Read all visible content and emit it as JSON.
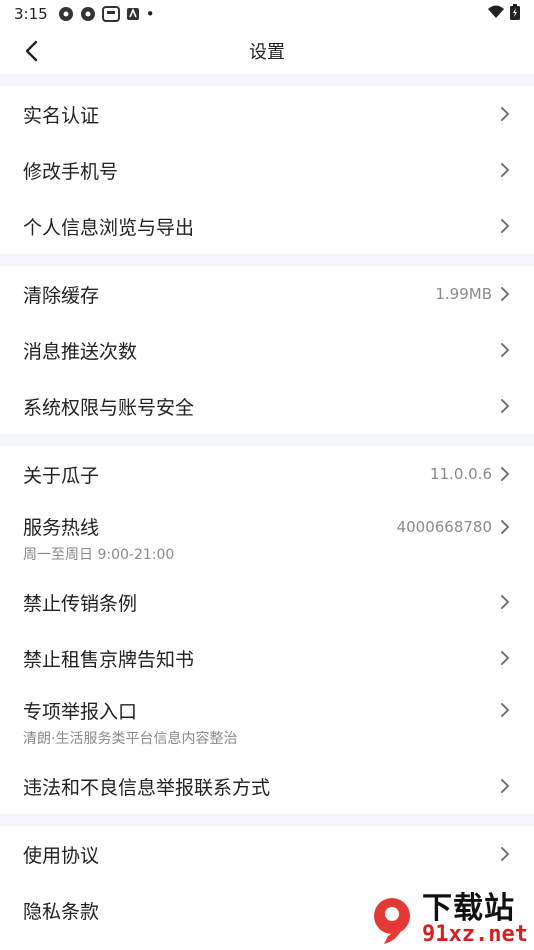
{
  "status_bar": {
    "time": "3:15",
    "icons": [
      "app-icon",
      "app-icon",
      "app-icon",
      "app-icon"
    ],
    "dot": "•"
  },
  "header": {
    "title": "设置",
    "back_icon": "chevron-left-icon"
  },
  "groups": [
    {
      "items": [
        {
          "label": "实名认证"
        },
        {
          "label": "修改手机号"
        },
        {
          "label": "个人信息浏览与导出"
        }
      ]
    },
    {
      "items": [
        {
          "label": "清除缓存",
          "value": "1.99MB"
        },
        {
          "label": "消息推送次数"
        },
        {
          "label": "系统权限与账号安全"
        }
      ]
    },
    {
      "items": [
        {
          "label": "关于瓜子",
          "value": "11.0.0.6"
        },
        {
          "label": "服务热线",
          "value": "4000668780",
          "subtitle": "周一至周日 9:00-21:00"
        },
        {
          "label": "禁止传销条例"
        },
        {
          "label": "禁止租售京牌告知书"
        },
        {
          "label": "专项举报入口",
          "subtitle": "清朗·生活服务类平台信息内容整治"
        },
        {
          "label": "违法和不良信息举报联系方式"
        }
      ]
    },
    {
      "items": [
        {
          "label": "使用协议"
        },
        {
          "label": "隐私条款"
        }
      ]
    }
  ],
  "watermark": {
    "line1": "下载站",
    "line2": "91xz.net",
    "mark": "9"
  },
  "colors": {
    "gap": "#f4f5f7",
    "text": "#222222",
    "secondary": "#8a8a8a",
    "watermark_red": "#d62020"
  }
}
